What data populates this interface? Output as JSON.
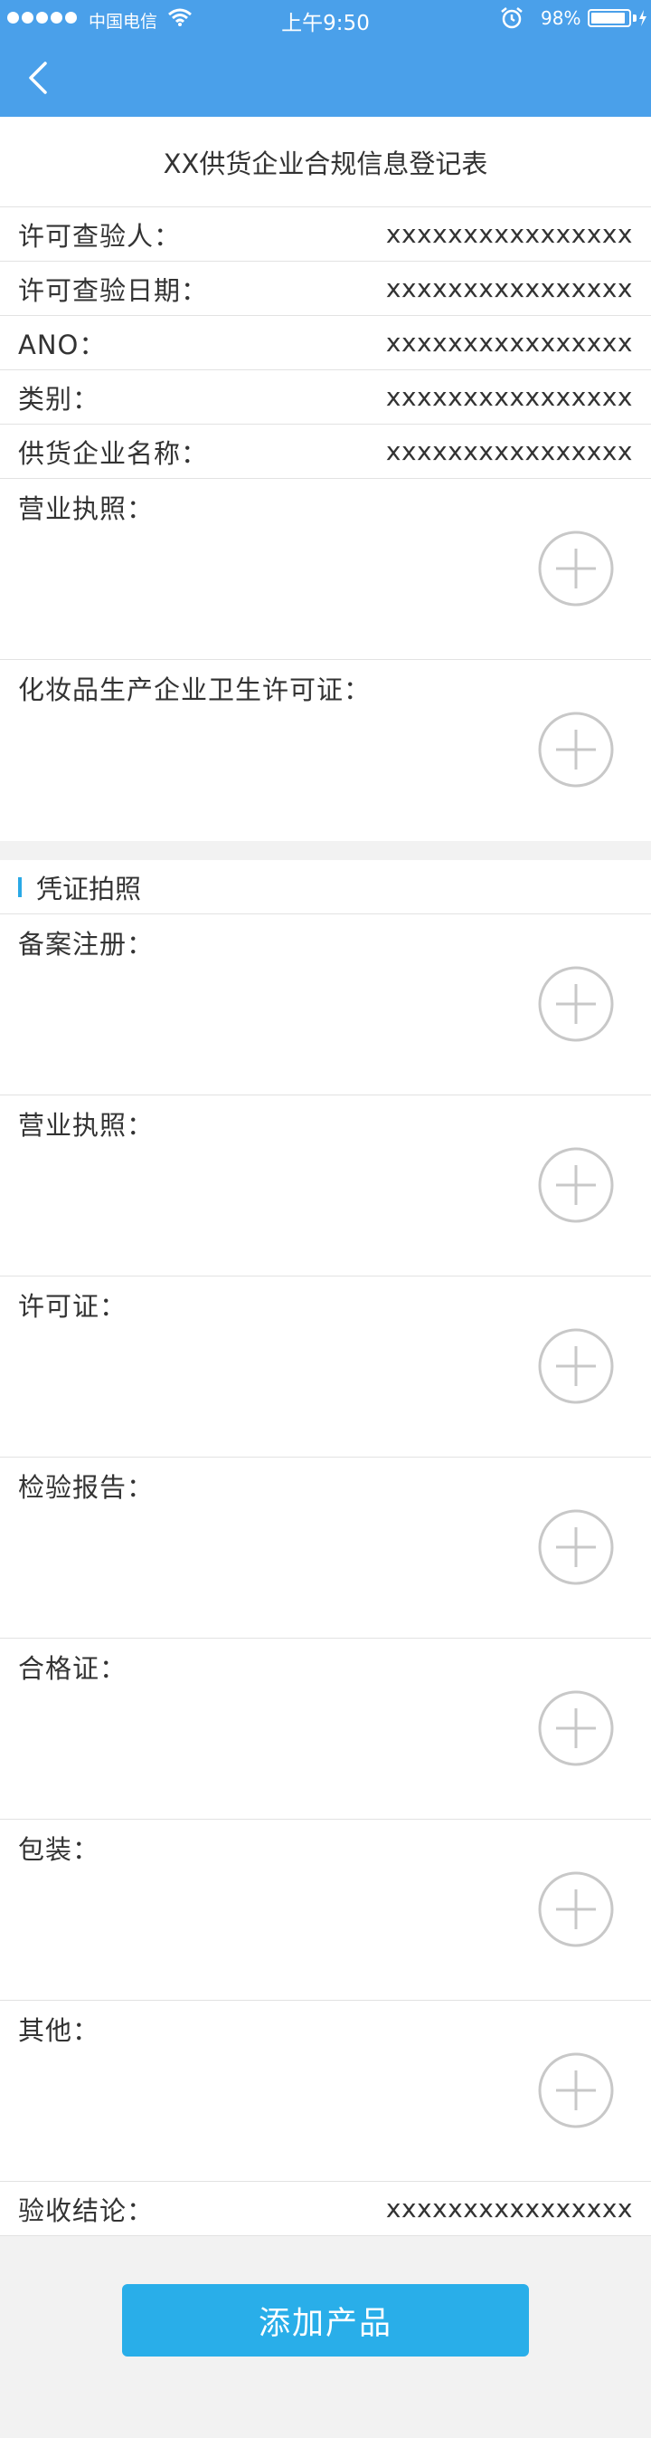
{
  "status_bar": {
    "carrier": "中国电信",
    "time": "上午9:50",
    "battery": "98%"
  },
  "nav": {
    "back_icon": "chevron-left-icon"
  },
  "form": {
    "title": "XX供货企业合规信息登记表",
    "info_rows": [
      {
        "label": "许可查验人：",
        "value": "xxxxxxxxxxxxxxxx"
      },
      {
        "label": "许可查验日期：",
        "value": "xxxxxxxxxxxxxxxx"
      },
      {
        "label": "ANO：",
        "value": "xxxxxxxxxxxxxxxx"
      },
      {
        "label": "类别：",
        "value": "xxxxxxxxxxxxxxxx"
      },
      {
        "label": "供货企业名称：",
        "value": "xxxxxxxxxxxxxxxx"
      }
    ],
    "license_uploads": [
      {
        "label": "营业执照："
      },
      {
        "label": "化妆品生产企业卫生许可证："
      }
    ],
    "section": {
      "title": "凭证拍照"
    },
    "voucher_uploads": [
      {
        "label": "备案注册："
      },
      {
        "label": "营业执照："
      },
      {
        "label": "许可证："
      },
      {
        "label": "检验报告："
      },
      {
        "label": "合格证："
      },
      {
        "label": "包装："
      },
      {
        "label": "其他："
      }
    ],
    "conclusion": {
      "label": "验收结论：",
      "value": "xxxxxxxxxxxxxxxx"
    },
    "submit_label": "添加产品"
  },
  "colors": {
    "header": "#4aa0ea",
    "accent": "#2aa9e6",
    "button": "#29aee9"
  }
}
